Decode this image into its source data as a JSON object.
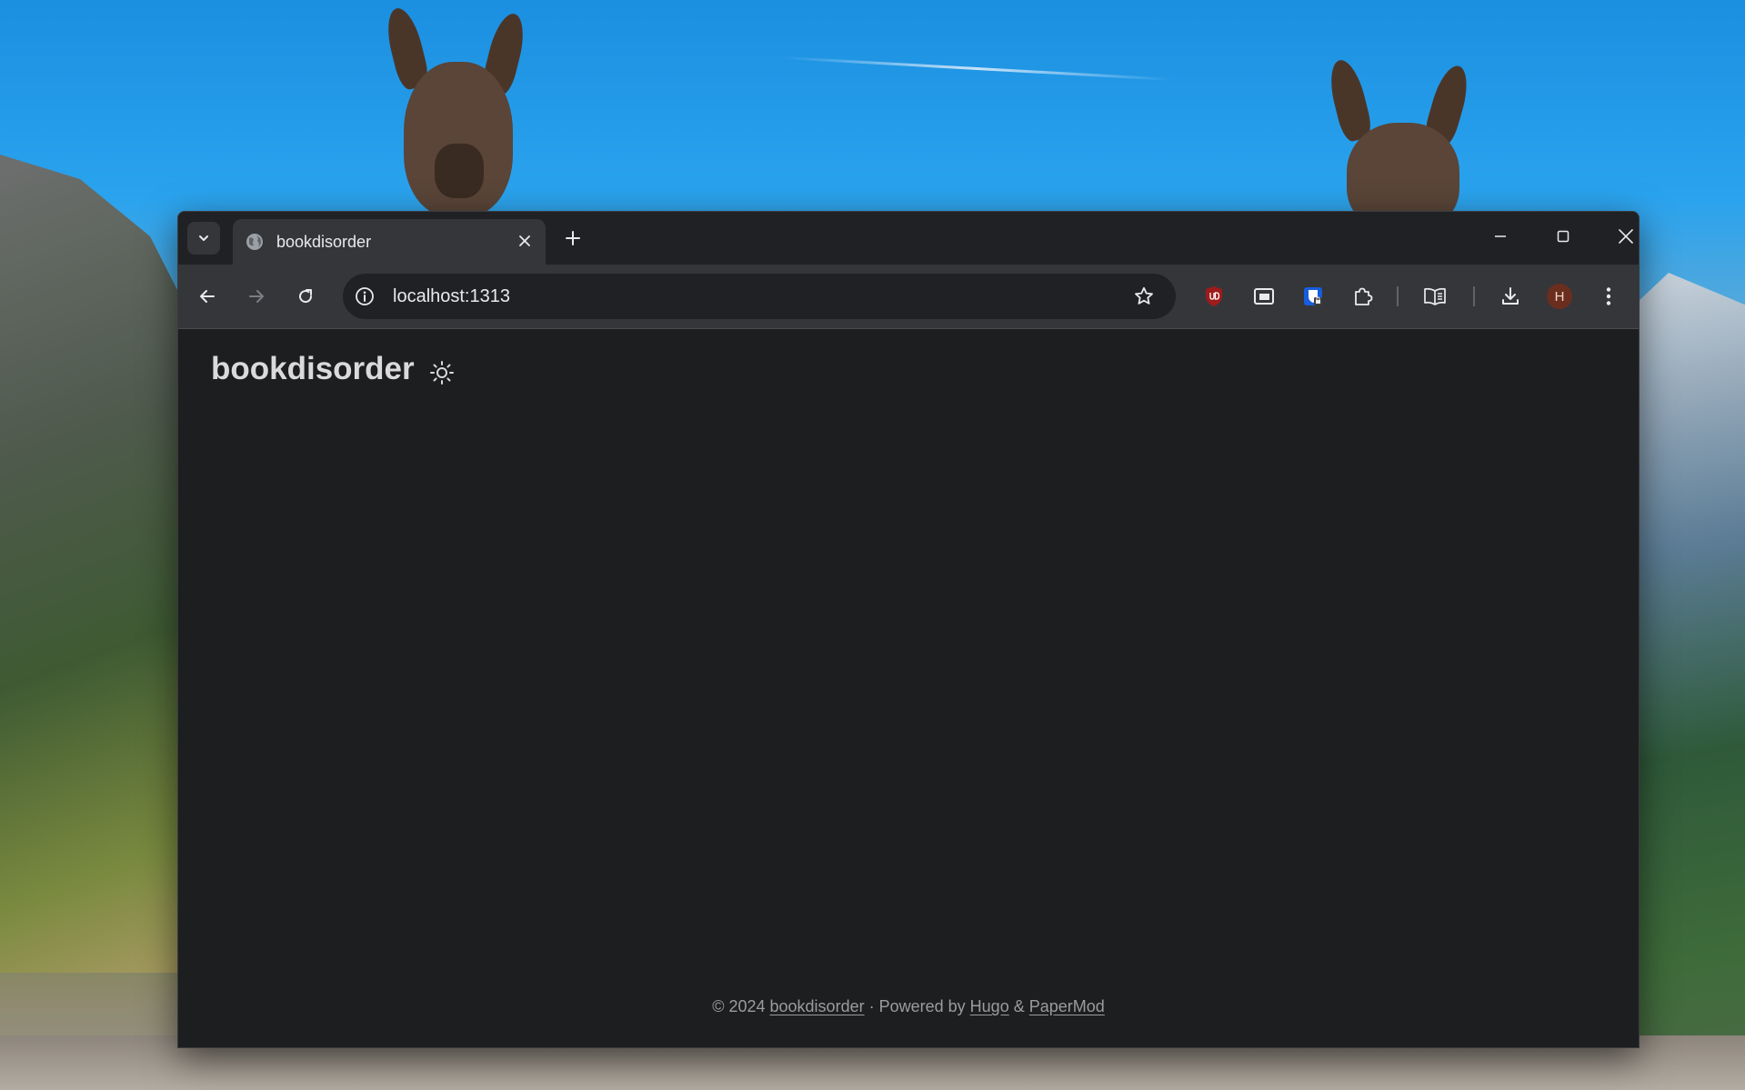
{
  "browser": {
    "tab": {
      "title": "bookdisorder"
    },
    "address_bar": {
      "url": "localhost:1313"
    },
    "profile_initial": "H"
  },
  "site": {
    "title": "bookdisorder",
    "footer": {
      "copyright": "© 2024",
      "site_link": "bookdisorder",
      "powered_text": "· Powered by",
      "hugo_link": "Hugo",
      "ampersand": "&",
      "theme_link": "PaperMod"
    }
  },
  "icons": {
    "tab_search": "chevron-down-icon",
    "favicon": "globe-icon",
    "tab_close": "close-icon",
    "new_tab": "plus-icon",
    "back": "arrow-left-icon",
    "forward": "arrow-right-icon",
    "reload": "reload-icon",
    "site_info": "info-icon",
    "bookmark": "star-icon",
    "ublock": "ublock-origin-icon",
    "picture_in_picture": "picture-in-picture-icon",
    "bitwarden": "password-manager-icon",
    "extensions": "puzzle-icon",
    "reading_mode": "book-open-icon",
    "downloads": "download-icon",
    "menu": "more-vertical-icon",
    "theme_toggle": "sun-icon"
  },
  "colors": {
    "page_bg": "#1d1e20",
    "title_text": "#dadadb",
    "footer_text": "#9b9c9d",
    "toolbar_bg": "#35363a",
    "titlebar_bg": "#202124",
    "ublock_red": "#9e1b1b",
    "bitwarden_blue": "#175ddc",
    "avatar_bg": "#6b2e1e"
  }
}
